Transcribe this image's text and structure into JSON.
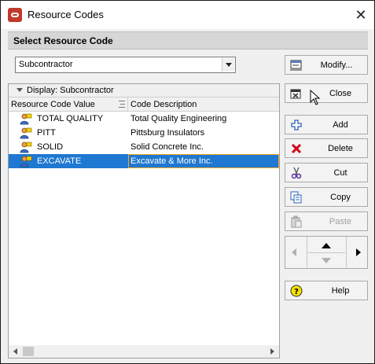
{
  "window": {
    "title": "Resource Codes",
    "close_glyph": "✕"
  },
  "section_header": "Select Resource Code",
  "combo": {
    "selected": "Subcontractor"
  },
  "buttons": {
    "modify": "Modify...",
    "close": "Close",
    "add": "Add",
    "delete": "Delete",
    "cut": "Cut",
    "copy": "Copy",
    "paste": "Paste",
    "help": "Help"
  },
  "table": {
    "group_label": "Display: Subcontractor",
    "columns": [
      "Resource Code Value",
      "Code Description"
    ],
    "rows": [
      {
        "value": "TOTAL QUALITY",
        "description": "Total Quality Engineering",
        "selected": false
      },
      {
        "value": "PITT",
        "description": "Pittsburg Insulators",
        "selected": false
      },
      {
        "value": "SOLID",
        "description": "Solid Concrete Inc.",
        "selected": false
      },
      {
        "value": "EXCAVATE",
        "description": "Excavate & More Inc.",
        "selected": true
      }
    ]
  },
  "icons": {
    "app": "oracle-logo-icon",
    "modify": "modify-icon",
    "close": "close-dialog-icon",
    "add": "plus-icon",
    "delete": "red-x-icon",
    "cut": "scissors-icon",
    "copy": "copy-icon",
    "paste": "paste-icon",
    "help": "help-icon",
    "row": "resource-person-icon"
  },
  "colors": {
    "selection": "#1f78d1",
    "focus_border": "#f5a623",
    "accent_red": "#c0392b"
  }
}
